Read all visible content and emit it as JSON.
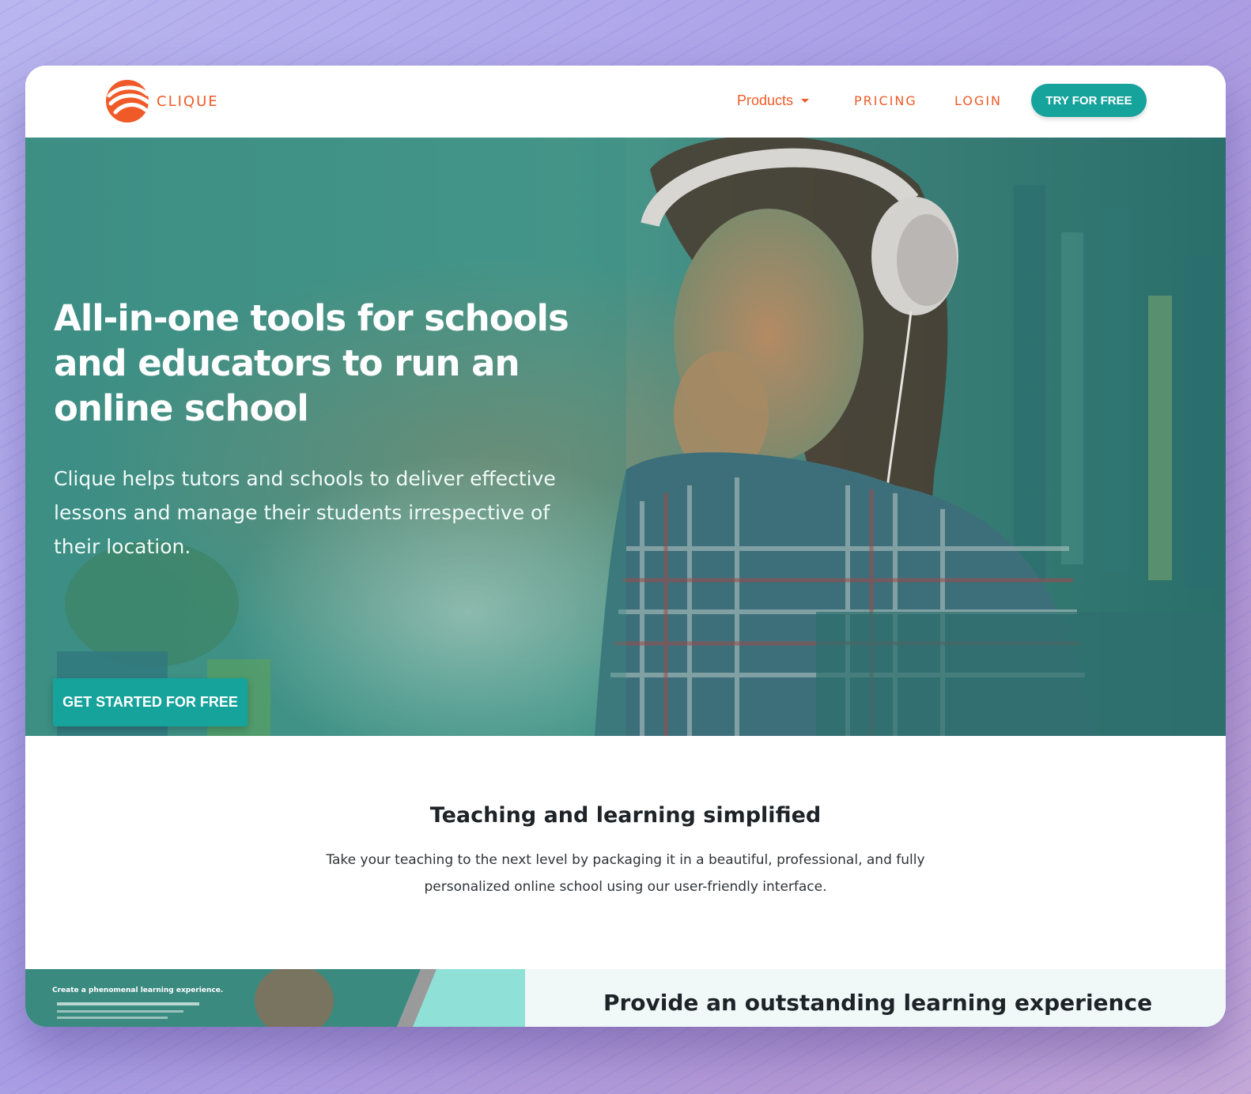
{
  "nav": {
    "logo_text": "CLIQUE",
    "products_label": "Products",
    "pricing_label": "PRICING",
    "login_label": "LOGIN",
    "cta_label": "TRY FOR FREE"
  },
  "hero": {
    "title": "All-in-one tools for schools and educators to run an online school",
    "subtitle": "Clique helps tutors and schools to deliver effective lessons and manage their students irrespective of their location.",
    "cta_label": "GET STARTED FOR FREE"
  },
  "section": {
    "title": "Teaching and learning simplified",
    "description": "Take your teaching to the next level by packaging it in a beautiful, professional, and fully personalized online school using our user-friendly interface."
  },
  "strip": {
    "title": "Provide an outstanding learning experience",
    "thumb_caption": "Create a phenomenal learning experience."
  },
  "colors": {
    "brand_orange": "#f05a28",
    "brand_teal": "#16a39c",
    "hero_overlay": "#2f8e84"
  }
}
